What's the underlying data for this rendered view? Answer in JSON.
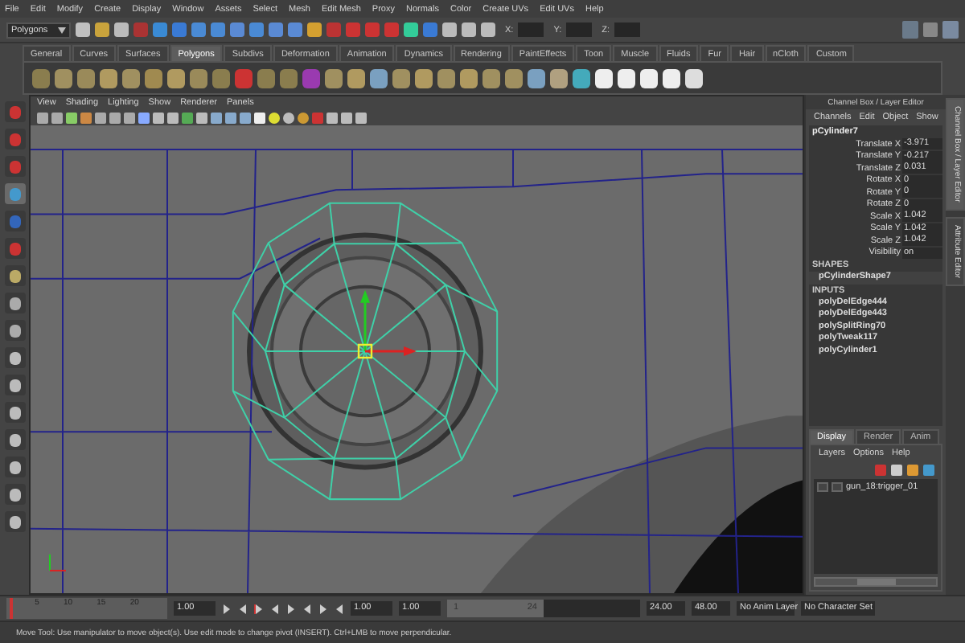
{
  "menu_bar": {
    "items": [
      "File",
      "Edit",
      "Modify",
      "Create",
      "Display",
      "Window",
      "Assets",
      "Select",
      "Mesh",
      "Edit Mesh",
      "Proxy",
      "Normals",
      "Color",
      "Create UVs",
      "Edit UVs",
      "Help"
    ]
  },
  "status_line": {
    "mode": "Polygons",
    "coordinate_fields": [
      {
        "label": "X:"
      },
      {
        "label": "Y:"
      },
      {
        "label": "Z:"
      }
    ]
  },
  "shelf": {
    "tabs": [
      {
        "label": "General",
        "selected": false
      },
      {
        "label": "Curves",
        "selected": false
      },
      {
        "label": "Surfaces",
        "selected": false
      },
      {
        "label": "Polygons",
        "selected": true
      },
      {
        "label": "Subdivs",
        "selected": false
      },
      {
        "label": "Deformation",
        "selected": false
      },
      {
        "label": "Animation",
        "selected": false
      },
      {
        "label": "Dynamics",
        "selected": false
      },
      {
        "label": "Rendering",
        "selected": false
      },
      {
        "label": "PaintEffects",
        "selected": false
      },
      {
        "label": "Toon",
        "selected": false
      },
      {
        "label": "Muscle",
        "selected": false
      },
      {
        "label": "Fluids",
        "selected": false
      },
      {
        "label": "Fur",
        "selected": false
      },
      {
        "label": "Hair",
        "selected": false
      },
      {
        "label": "nCloth",
        "selected": false
      },
      {
        "label": "Custom",
        "selected": false
      }
    ]
  },
  "viewport": {
    "panel_menu": [
      "View",
      "Shading",
      "Lighting",
      "Show",
      "Renderer",
      "Panels"
    ]
  },
  "channel_box": {
    "title": "Channel Box / Layer Editor",
    "menu": [
      "Channels",
      "Edit",
      "Object",
      "Show"
    ],
    "object": "pCylinder7",
    "channels": [
      {
        "name": "Translate X",
        "value": "-3.971"
      },
      {
        "name": "Translate Y",
        "value": "-0.217"
      },
      {
        "name": "Translate Z",
        "value": "0.031"
      },
      {
        "name": "Rotate X",
        "value": "0"
      },
      {
        "name": "Rotate Y",
        "value": "0"
      },
      {
        "name": "Rotate Z",
        "value": "0"
      },
      {
        "name": "Scale X",
        "value": "1.042"
      },
      {
        "name": "Scale Y",
        "value": "1.042"
      },
      {
        "name": "Scale Z",
        "value": "1.042"
      },
      {
        "name": "Visibility",
        "value": "on"
      }
    ],
    "shapes_header": "SHAPES",
    "shapes": [
      "pCylinderShape7"
    ],
    "inputs_header": "INPUTS",
    "inputs": [
      "polyDelEdge444",
      "polyDelEdge443",
      "polySplitRing70",
      "polyTweak117",
      "polyCylinder1"
    ]
  },
  "layer_editor": {
    "tabs": [
      {
        "label": "Display",
        "selected": true
      },
      {
        "label": "Render",
        "selected": false
      },
      {
        "label": "Anim",
        "selected": false
      }
    ],
    "menu": [
      "Layers",
      "Options",
      "Help"
    ],
    "layers": [
      {
        "name": "gun_18:trigger_01"
      }
    ]
  },
  "side_tabs": [
    {
      "label": "Channel Box / Layer Editor",
      "selected": true
    },
    {
      "label": "Attribute Editor",
      "selected": false
    }
  ],
  "time_slider": {
    "ticks": [
      "5",
      "10",
      "15",
      "20"
    ],
    "current_time": "1.00",
    "level": 0.02
  },
  "range_slider": {
    "start": "1.00",
    "playback_start": "1.00",
    "range_start": "1",
    "range_end": "24",
    "playback_end": "24.00",
    "end": "48.00",
    "level": 0.5
  },
  "anim_layer": "No Anim Layer",
  "character_set": "No Character Set",
  "help_line": "Move Tool: Use manipulator to move object(s). Use edit mode to change pivot (INSERT).  Ctrl+LMB to move perpendicular."
}
